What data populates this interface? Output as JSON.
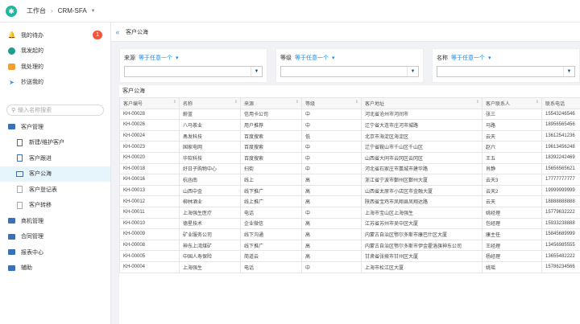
{
  "topbar": {
    "home": "工作台",
    "app": "CRM-SFA"
  },
  "sidebar": {
    "top_items": [
      {
        "label": "我的待办",
        "badge": "1"
      },
      {
        "label": "我发起的"
      },
      {
        "label": "我处理的"
      },
      {
        "label": "抄送我的"
      }
    ],
    "search_placeholder": "输入名称搜索",
    "groups": [
      {
        "label": "客户管理"
      },
      {
        "label": "新建/维护客户"
      },
      {
        "label": "客户跟进"
      },
      {
        "label": "客户公海"
      },
      {
        "label": "客户登记表"
      },
      {
        "label": "客户转移"
      },
      {
        "label": "商机管理"
      },
      {
        "label": "合同管理"
      },
      {
        "label": "报表中心"
      },
      {
        "label": "辅助"
      }
    ]
  },
  "main": {
    "tab_title": "客户公海",
    "filters": [
      {
        "label": "来源",
        "op": "等于任意一个"
      },
      {
        "label": "等级",
        "op": "等于任意一个"
      },
      {
        "label": "名称",
        "op": "等于任意一个"
      }
    ],
    "table_title": "客户公海",
    "columns": [
      "客户编号",
      "名称",
      "来源",
      "等级",
      "客户地址",
      "客户联系人",
      "联系电话"
    ],
    "rows": [
      [
        "KH-00028",
        "蔚蓝",
        "信用卡公司",
        "中",
        "河北省沧州市河间市",
        "张三",
        "15543246546"
      ],
      [
        "KH-00026",
        "八马茶业",
        "用户推荐",
        "中",
        "辽宁省大连市庄河市城路",
        "马路",
        "18956565456"
      ],
      [
        "KH-00024",
        "甬发科技",
        "百度搜索",
        "低",
        "北京市海淀区海淀区",
        "云天",
        "13612541236"
      ],
      [
        "KH-00023",
        "国家电网",
        "百度搜索",
        "中",
        "辽宁省鞍山市千山区千山区",
        "赵六",
        "19613456248"
      ],
      [
        "KH-00020",
        "华软科技",
        "百度搜索",
        "中",
        "山西省大同市云冈区云冈区",
        "王五",
        "18392242469"
      ],
      [
        "KH-00018",
        "好日子购物中心",
        "扫街",
        "中",
        "河北省石家庄市藁城市建华路",
        "肖静",
        "15656565621"
      ],
      [
        "KH-00016",
        "杭函南",
        "线上",
        "高",
        "浙江省宁波市鄞州区鄞州大厦",
        "云天3",
        "17777777777"
      ],
      [
        "KH-00013",
        "山西中金",
        "线下推广",
        "高",
        "山西省太原市小店区市金融大厦",
        "云天2",
        "19999999999"
      ],
      [
        "KH-00012",
        "柳林酒业",
        "线上推广",
        "高",
        "陕西省宝鸡市凤翔县凤翔达路",
        "云天",
        "18888888888"
      ],
      [
        "KH-00011",
        "上海强生医疗",
        "电话",
        "中",
        "上海市宝山区上海强生",
        "姚经理",
        "15779632222"
      ],
      [
        "KH-00010",
        "德星技术",
        "企业微信",
        "高",
        "江苏省苏州市吴中区大厦",
        "包经理",
        "15933238888"
      ],
      [
        "KH-00009",
        "矿业服务公司",
        "线下沟通",
        "高",
        "内蒙古自治区鄂尔多斯市康巴什区大厦",
        "康主任",
        "15845689999"
      ],
      [
        "KH-00008",
        "神东上湾煤矿",
        "线下推广",
        "高",
        "内蒙古自治区鄂尔多斯市伊金霍洛旗神东公司",
        "王经理",
        "13456985555"
      ],
      [
        "KH-00005",
        "中国人寿保险",
        "简道云",
        "高",
        "甘肃省张掖市甘州区大厦",
        "杨经理",
        "13655482222"
      ],
      [
        "KH-00004",
        "上海强生",
        "电话",
        "中",
        "上海市松江区大厦",
        "姚瑶",
        "15786234566"
      ]
    ]
  }
}
